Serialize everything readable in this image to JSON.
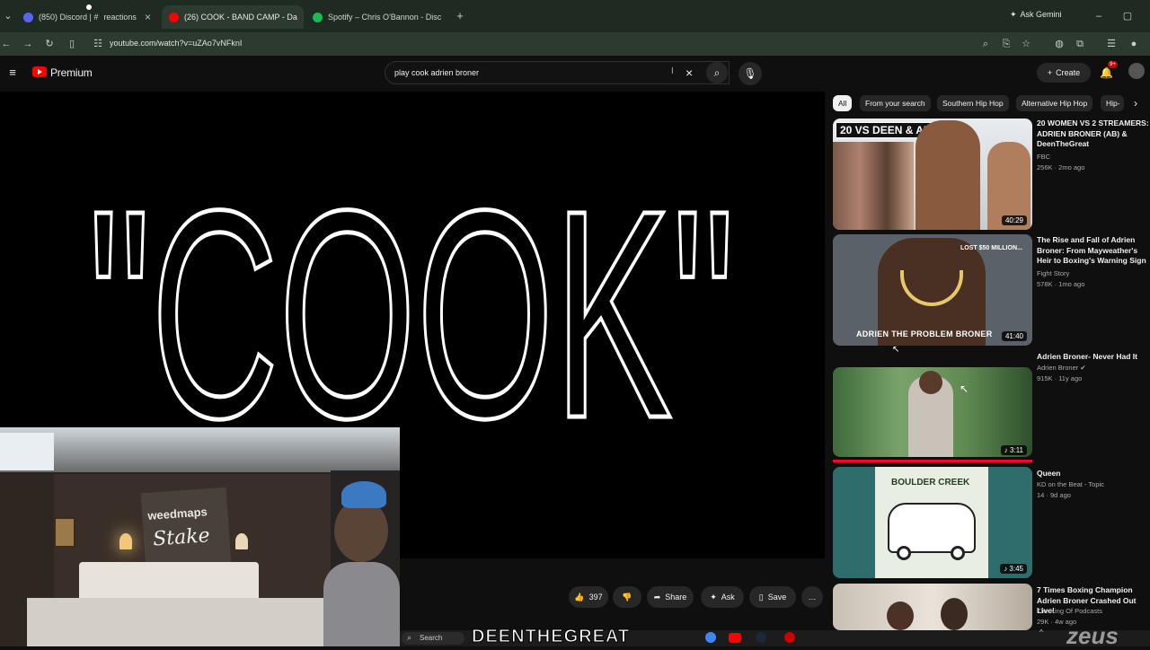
{
  "browser": {
    "tabs": [
      {
        "label": "(850) Discord | # ",
        "label2": "reactions",
        "fav_color": "#5865f2"
      },
      {
        "label": "(26) COOK - BAND CAMP - Da",
        "fav_color": "#ff0000"
      },
      {
        "label": "Spotify – Chris O'Bannon - Disc",
        "fav_color": "#1db954"
      }
    ],
    "new_tab": "+",
    "ask_gemini": "Ask Gemini",
    "url": "youtube.com/watch?v=uZAo7vNFknI"
  },
  "youtube": {
    "brand": "Premium",
    "search_value": "play cook adrien broner",
    "create_label": "Create",
    "notif_count": "9+"
  },
  "video": {
    "title_art": "\"COOK\"",
    "likes": "397",
    "share_label": "Share",
    "ask_label": "Ask",
    "save_label": "Save",
    "more": "…"
  },
  "chips": [
    "All",
    "From your search",
    "Southern Hip Hop",
    "Alternative Hip Hop",
    "Hip-"
  ],
  "recommendations": [
    {
      "title": "20 WOMEN VS 2 STREAMERS: ADRIEN BRONER (AB) & DeenTheGreat",
      "channel": "FBC",
      "meta": "256K · 2mo ago",
      "duration": "40:29",
      "overlay": "20 VS DEEN & AB"
    },
    {
      "title": "The Rise and Fall of Adrien Broner: From Mayweather's Heir to Boxing's Warning Sign",
      "channel": "Fight Story",
      "meta": "578K · 1mo ago",
      "duration": "41:40",
      "overlay": "ADRIEN THE PROBLEM BRONER",
      "overlay2": "LOST $50 MILLION..."
    },
    {
      "title": "Adrien Broner- Never Had It",
      "channel": "Adrien Broner ✔",
      "meta": "915K · 11y ago",
      "duration": "♪ 3:11"
    },
    {
      "title": "Queen",
      "channel": "KD on the Beat - Topic",
      "meta": "14 · 9d ago",
      "duration": "♪ 3:45",
      "overlay": "BOULDER CREEK"
    },
    {
      "title": "7 Times Boxing Champion Adrien Broner Crashed Out Live!",
      "channel": "The King Of Podcasts",
      "meta": "29K · 4w ago"
    }
  ],
  "webcam": {
    "sign": "weedmaps",
    "sign2": "Stake"
  },
  "taskbar": {
    "search": "Search",
    "banner": "DEENTHEGREAT",
    "corner": "zeus"
  }
}
